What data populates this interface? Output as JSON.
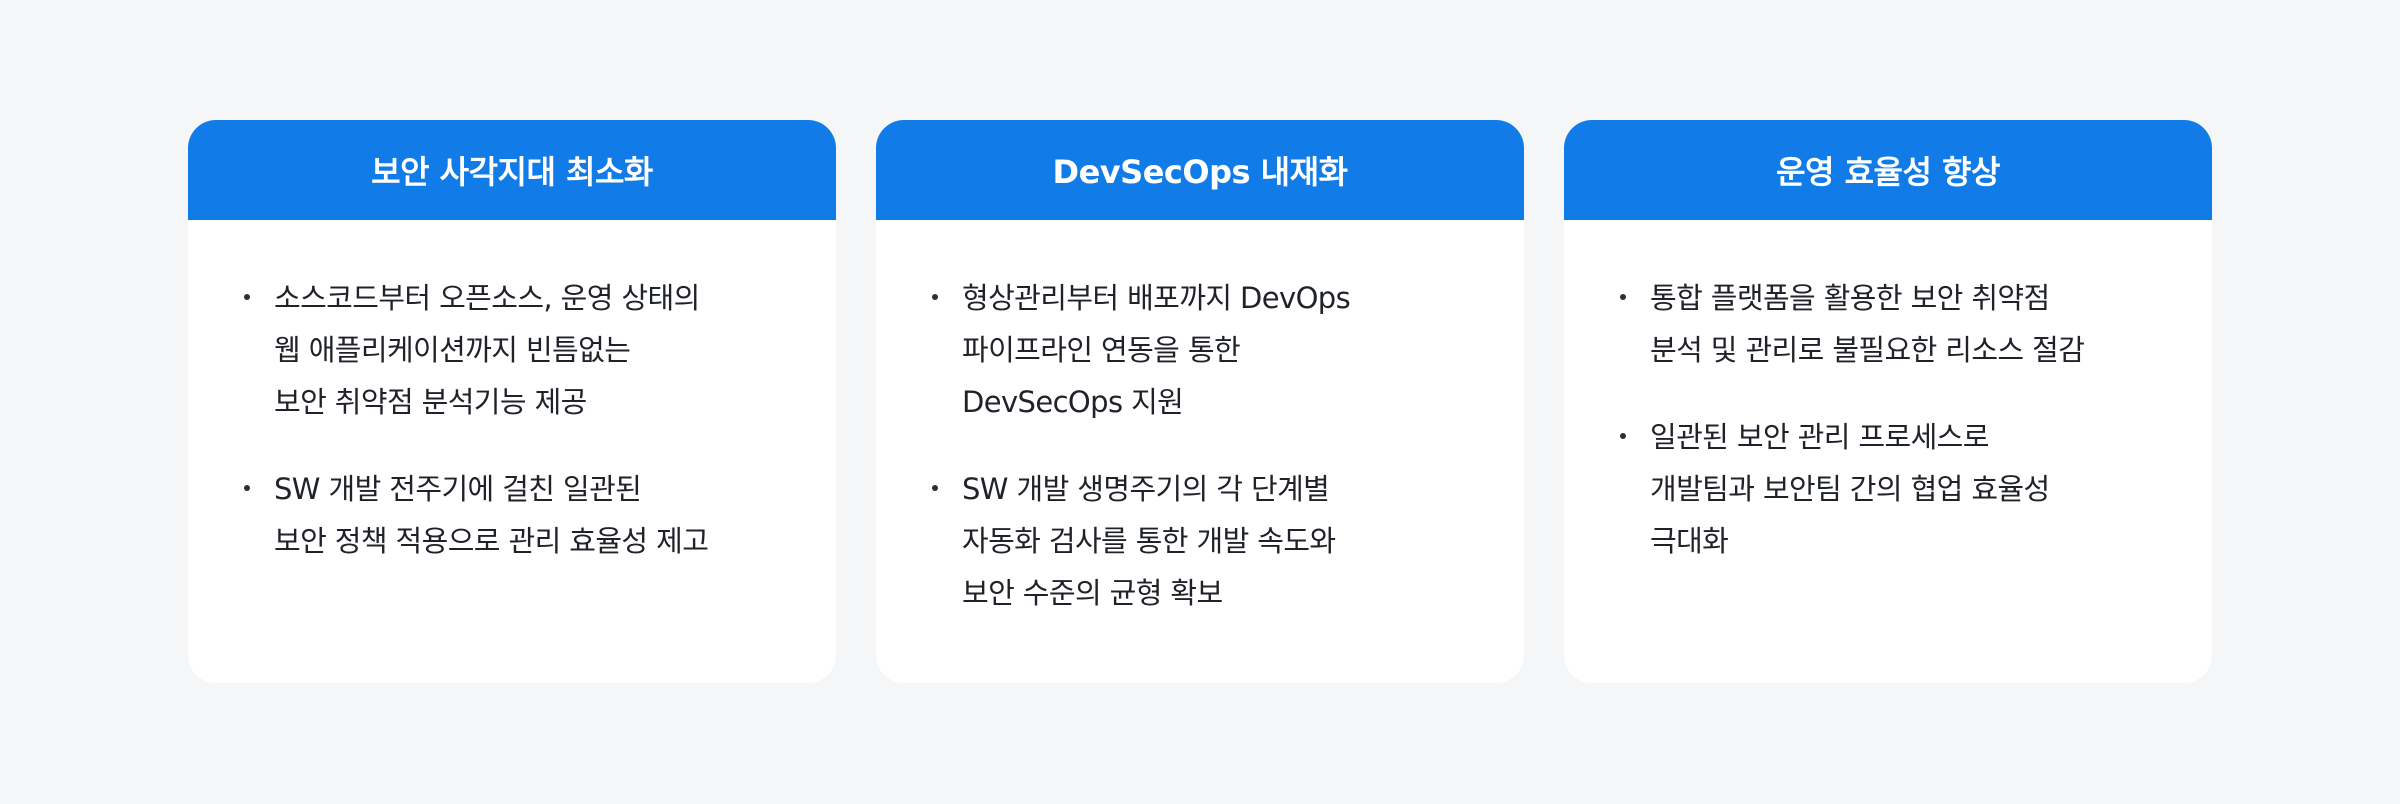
{
  "colors": {
    "page_background": "#f5f6f8",
    "header_background": "#117be8",
    "card_background": "#ffffff",
    "text": "#1f2329"
  },
  "cards": [
    {
      "title": "보안 사각지대 최소화",
      "bullets": [
        [
          "소스코드부터 오픈소스, 운영 상태의",
          "웹 애플리케이션까지 빈틈없는",
          "보안 취약점 분석기능 제공"
        ],
        [
          "SW 개발 전주기에 걸친 일관된",
          "보안 정책 적용으로 관리 효율성 제고"
        ]
      ]
    },
    {
      "title": "DevSecOps 내재화",
      "bullets": [
        [
          "형상관리부터 배포까지 DevOps",
          "파이프라인 연동을 통한",
          "DevSecOps 지원"
        ],
        [
          "SW 개발 생명주기의 각 단계별",
          "자동화 검사를 통한 개발 속도와",
          "보안 수준의 균형 확보"
        ]
      ]
    },
    {
      "title": "운영 효율성 향상",
      "bullets": [
        [
          "통합 플랫폼을 활용한 보안 취약점",
          "분석 및 관리로 불필요한 리소스 절감"
        ],
        [
          "일관된 보안 관리 프로세스로",
          "개발팀과 보안팀 간의 협업 효율성",
          "극대화"
        ]
      ]
    }
  ]
}
